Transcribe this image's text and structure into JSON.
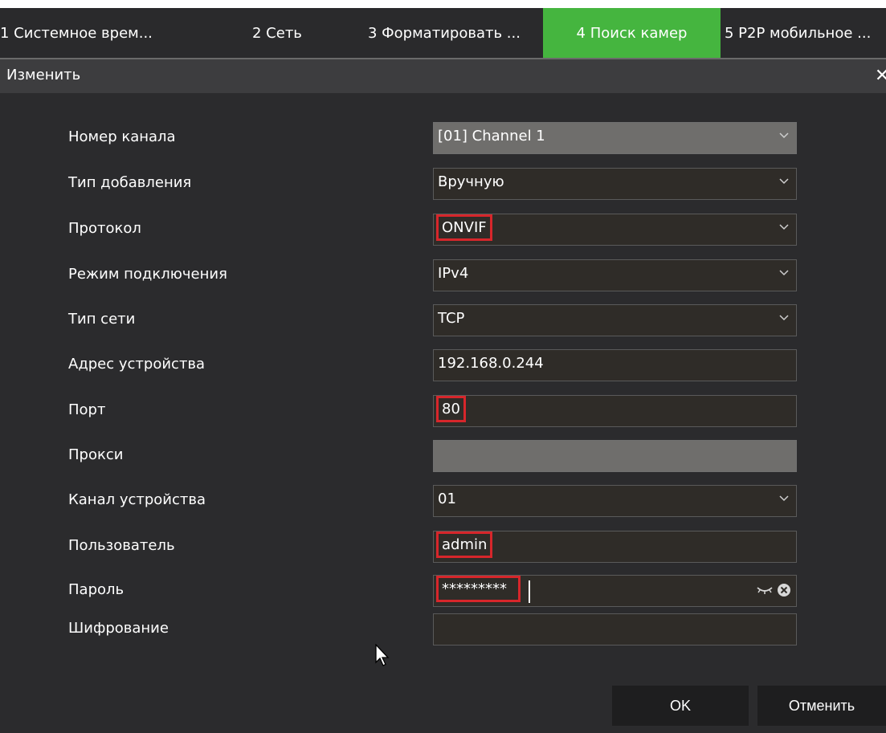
{
  "tabs": [
    {
      "label": "1 Системное врем..."
    },
    {
      "label": "2 Сеть"
    },
    {
      "label": "3 Форматировать ..."
    },
    {
      "label": "4 Поиск камер"
    },
    {
      "label": "5 P2P мобильное ..."
    }
  ],
  "dialog": {
    "title": "Изменить",
    "close_icon": "close-icon"
  },
  "fields": {
    "channel_number": {
      "label": "Номер канала",
      "value": "[01] Channel 1"
    },
    "add_type": {
      "label": "Тип добавления",
      "value": "Вручную"
    },
    "protocol": {
      "label": "Протокол",
      "value": "ONVIF"
    },
    "connection_mode": {
      "label": "Режим подключения",
      "value": "IPv4"
    },
    "network_type": {
      "label": "Тип сети",
      "value": "TCP"
    },
    "device_address": {
      "label": "Адрес устройства",
      "value": "192.168.0.244"
    },
    "port": {
      "label": "Порт",
      "value": "80"
    },
    "proxy": {
      "label": "Прокси",
      "value": ""
    },
    "device_channel": {
      "label": "Канал устройства",
      "value": "01"
    },
    "user": {
      "label": "Пользователь",
      "value": "admin"
    },
    "password": {
      "label": "Пароль",
      "value": "*********"
    },
    "encryption": {
      "label": "Шифрование",
      "value": ""
    }
  },
  "buttons": {
    "ok": "OK",
    "cancel": "Отменить"
  },
  "colors": {
    "active_tab": "#45b53f",
    "highlight": "#d7262b",
    "background": "#2b2b2d"
  }
}
